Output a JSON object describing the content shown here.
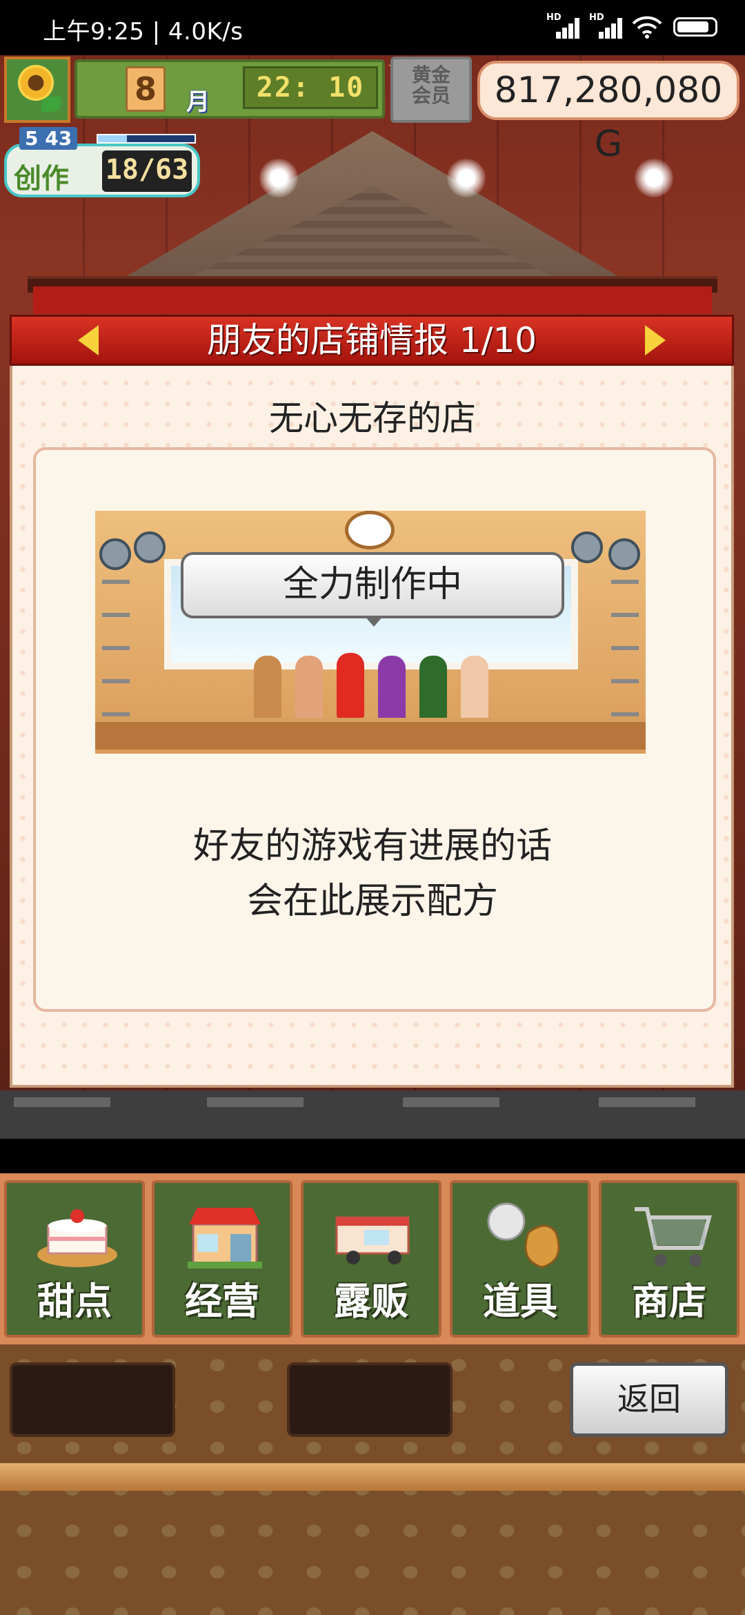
{
  "status_bar": {
    "time": "上午9:25 | 4.0K/s"
  },
  "hud": {
    "month_number": "8",
    "month_label": "月",
    "clock": "22: 10",
    "gold_member_badge": "黄金\n会员",
    "money": "817,280,080 G",
    "level": "5 43",
    "create_label": "创作",
    "create_count": "18/63"
  },
  "panel": {
    "title": "朋友的店铺情报 1/10",
    "shop_name": "无心无存的店",
    "bubble": "全力制作中",
    "message_line1": "好友的游戏有进展的话",
    "message_line2": "会在此展示配方"
  },
  "menu": {
    "items": [
      {
        "label": "甜点",
        "icon": "cake-icon"
      },
      {
        "label": "经营",
        "icon": "shop-icon"
      },
      {
        "label": "露贩",
        "icon": "food-truck-icon"
      },
      {
        "label": "道具",
        "icon": "items-bag-icon"
      },
      {
        "label": "商店",
        "icon": "shopping-cart-icon"
      }
    ]
  },
  "back_button": "返回"
}
